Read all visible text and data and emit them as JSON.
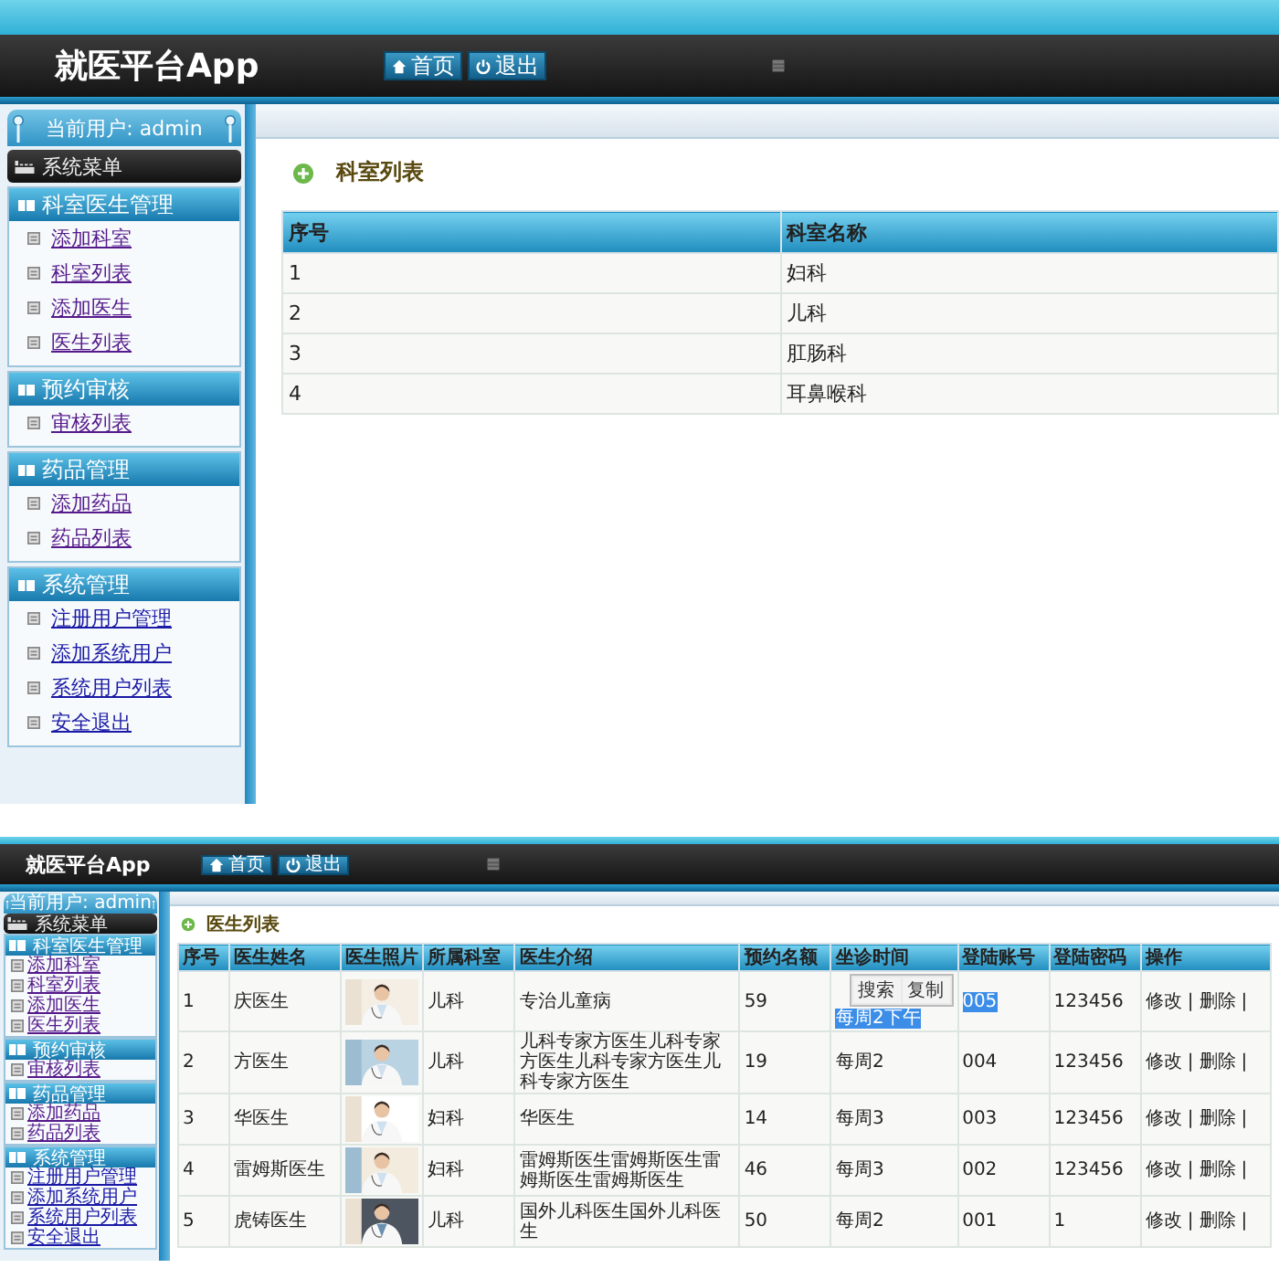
{
  "screens": [
    {
      "header": {
        "title": "就医平台App",
        "nav": [
          {
            "kind": "home",
            "label": "首页"
          },
          {
            "kind": "power",
            "label": "退出"
          }
        ]
      },
      "sidebar": {
        "user": "当前用户: admin",
        "menu_title": "系统菜单",
        "groups": [
          {
            "title": "科室医生管理",
            "items": [
              {
                "label": "添加科室",
                "visited": true
              },
              {
                "label": "科室列表",
                "visited": true
              },
              {
                "label": "添加医生",
                "visited": true
              },
              {
                "label": "医生列表",
                "visited": true
              }
            ]
          },
          {
            "title": "预约审核",
            "items": [
              {
                "label": "审核列表",
                "visited": true
              }
            ]
          },
          {
            "title": "药品管理",
            "items": [
              {
                "label": "添加药品",
                "visited": true
              },
              {
                "label": "药品列表",
                "visited": true
              }
            ]
          },
          {
            "title": "系统管理",
            "items": [
              {
                "label": "注册用户管理",
                "visited": false
              },
              {
                "label": "添加系统用户",
                "visited": false
              },
              {
                "label": "系统用户列表",
                "visited": false
              },
              {
                "label": "安全退出",
                "visited": false
              }
            ]
          }
        ]
      },
      "main": {
        "title": "科室列表",
        "columns": [
          {
            "label": "序号"
          },
          {
            "label": "科室名称"
          }
        ],
        "rows": [
          {
            "cells": [
              {
                "text": "1"
              },
              {
                "text": "妇科"
              }
            ]
          },
          {
            "cells": [
              {
                "text": "2"
              },
              {
                "text": "儿科"
              }
            ]
          },
          {
            "cells": [
              {
                "text": "3"
              },
              {
                "text": "肛肠科"
              }
            ]
          },
          {
            "cells": [
              {
                "text": "4"
              },
              {
                "text": "耳鼻喉科"
              }
            ]
          }
        ]
      }
    },
    {
      "header": {
        "title": "就医平台App",
        "nav": [
          {
            "kind": "home",
            "label": "首页"
          },
          {
            "kind": "power",
            "label": "退出"
          }
        ]
      },
      "sidebar": {
        "user": "当前用户: admin",
        "menu_title": "系统菜单",
        "groups": [
          {
            "title": "科室医生管理",
            "items": [
              {
                "label": "添加科室",
                "visited": true
              },
              {
                "label": "科室列表",
                "visited": true
              },
              {
                "label": "添加医生",
                "visited": true
              },
              {
                "label": "医生列表",
                "visited": true
              }
            ]
          },
          {
            "title": "预约审核",
            "items": [
              {
                "label": "审核列表",
                "visited": true
              }
            ]
          },
          {
            "title": "药品管理",
            "items": [
              {
                "label": "添加药品",
                "visited": true
              },
              {
                "label": "药品列表",
                "visited": true
              }
            ]
          },
          {
            "title": "系统管理",
            "items": [
              {
                "label": "注册用户管理",
                "visited": false
              },
              {
                "label": "添加系统用户",
                "visited": false
              },
              {
                "label": "系统用户列表",
                "visited": false
              },
              {
                "label": "安全退出",
                "visited": false
              }
            ]
          }
        ]
      },
      "main": {
        "title": "医生列表",
        "columns": [
          {
            "label": "序号"
          },
          {
            "label": "医生姓名"
          },
          {
            "label": "医生照片"
          },
          {
            "label": "所属科室"
          },
          {
            "label": "医生介绍"
          },
          {
            "label": "预约名额"
          },
          {
            "label": "坐诊时间"
          },
          {
            "label": "登陆账号"
          },
          {
            "label": "登陆密码"
          },
          {
            "label": "操作"
          }
        ],
        "rows": [
          {
            "cells": [
              {
                "text": "1"
              },
              {
                "text": "庆医生"
              },
              {
                "kind": "picture"
              },
              {
                "text": "儿科"
              },
              {
                "text": "专治儿童病"
              },
              {
                "text": "59"
              },
              {
                "text": "每周2下午",
                "highlighted": true,
                "popup": [
                  "搜索",
                  "复制"
                ]
              },
              {
                "text": "005",
                "highlighted": true
              },
              {
                "text": "123456"
              },
              {
                "kind": "actions",
                "links": [
                  "修改",
                  "删除"
                ],
                "separator": "|"
              }
            ]
          },
          {
            "cells": [
              {
                "text": "2"
              },
              {
                "text": "方医生"
              },
              {
                "kind": "picture"
              },
              {
                "text": "儿科"
              },
              {
                "text": "儿科专家方医生儿科专家方医生儿科专家方医生儿科专家方医生"
              },
              {
                "text": "19"
              },
              {
                "text": "每周2"
              },
              {
                "text": "004"
              },
              {
                "text": "123456"
              },
              {
                "kind": "actions",
                "links": [
                  "修改",
                  "删除"
                ],
                "separator": "|"
              }
            ]
          },
          {
            "cells": [
              {
                "text": "3"
              },
              {
                "text": "华医生"
              },
              {
                "kind": "picture"
              },
              {
                "text": "妇科"
              },
              {
                "text": "华医生"
              },
              {
                "text": "14"
              },
              {
                "text": "每周3"
              },
              {
                "text": "003"
              },
              {
                "text": "123456"
              },
              {
                "kind": "actions",
                "links": [
                  "修改",
                  "删除"
                ],
                "separator": "|"
              }
            ]
          },
          {
            "cells": [
              {
                "text": "4"
              },
              {
                "text": "雷姆斯医生"
              },
              {
                "kind": "picture"
              },
              {
                "text": "妇科"
              },
              {
                "text": "雷姆斯医生雷姆斯医生雷姆斯医生雷姆斯医生"
              },
              {
                "text": "46"
              },
              {
                "text": "每周3"
              },
              {
                "text": "002"
              },
              {
                "text": "123456"
              },
              {
                "kind": "actions",
                "links": [
                  "修改",
                  "删除"
                ],
                "separator": "|"
              }
            ]
          },
          {
            "cells": [
              {
                "text": "5"
              },
              {
                "text": "虎铸医生"
              },
              {
                "kind": "picture"
              },
              {
                "text": "儿科"
              },
              {
                "text": "国外儿科医生国外儿科医生"
              },
              {
                "text": "50"
              },
              {
                "text": "每周2"
              },
              {
                "text": "001"
              },
              {
                "text": "1"
              },
              {
                "kind": "actions",
                "links": [
                  "修改",
                  "删除"
                ],
                "separator": "|"
              }
            ]
          }
        ]
      }
    }
  ]
}
